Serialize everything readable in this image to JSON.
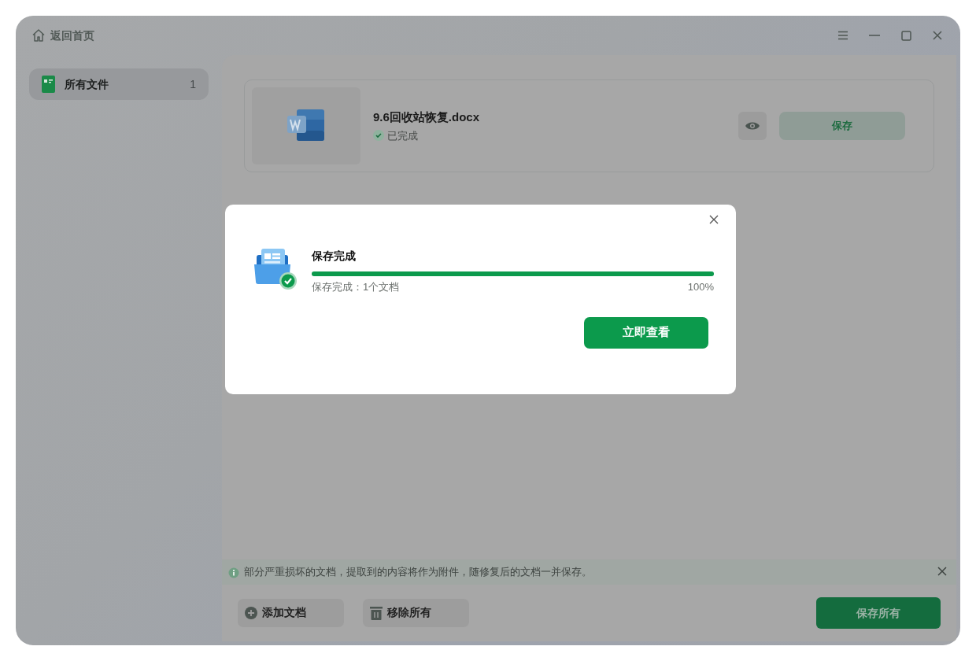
{
  "window": {
    "back_label": "返回首页"
  },
  "sidebar": {
    "items": [
      {
        "label": "所有文件",
        "count": "1",
        "selected": true
      }
    ]
  },
  "files": [
    {
      "name": "9.6回收站恢复.docx",
      "status": "已完成",
      "save_label": "保存"
    }
  ],
  "notice": {
    "text": "部分严重损坏的文档，提取到的内容将作为附件，随修复后的文档一并保存。"
  },
  "footer": {
    "buttons": [
      {
        "label": "添加文档",
        "kind": "add"
      },
      {
        "label": "移除所有",
        "kind": "remove"
      }
    ],
    "primary": "保存所有"
  },
  "dialog": {
    "title": "保存完成",
    "progress": {
      "level": 1
    },
    "detail": "保存完成：1个文档",
    "percent": "100%",
    "button": "立即查看"
  }
}
